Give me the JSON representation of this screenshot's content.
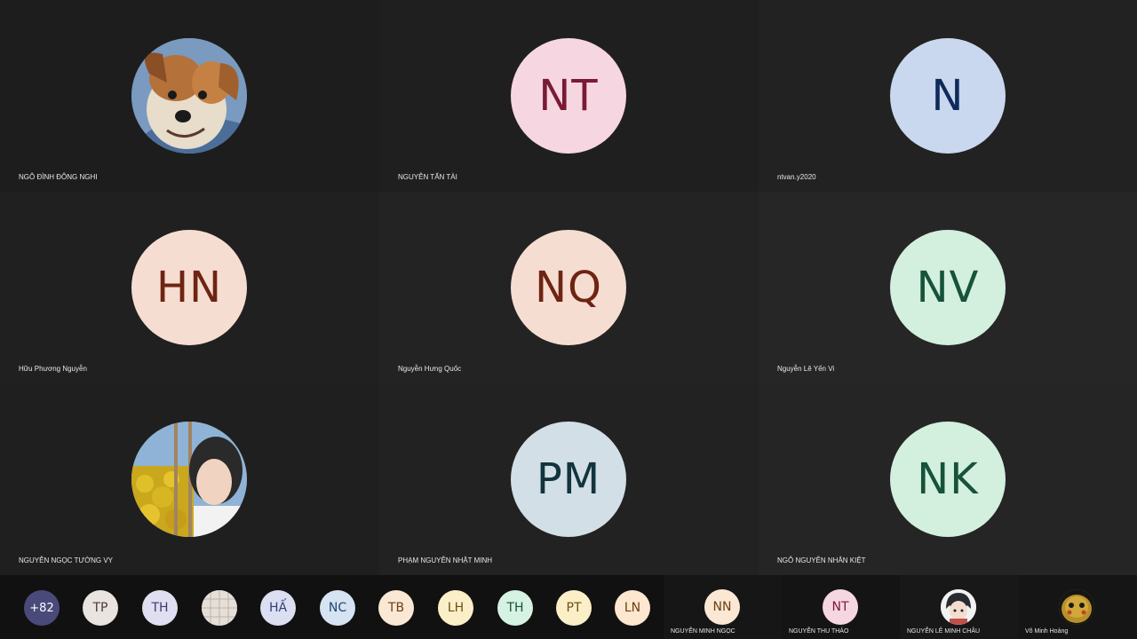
{
  "tiles": [
    {
      "name": "NGÔ ĐÌNH ĐÔNG NGHI",
      "initials": "",
      "photo": "dog",
      "bg": "#9a7a5a",
      "fg": "#000"
    },
    {
      "name": "NGUYỄN TẤN TÀI",
      "initials": "NT",
      "bg": "#f6d7e1",
      "fg": "#7a1a36"
    },
    {
      "name": "ntvan.y2020",
      "initials": "N",
      "bg": "#c9d8ee",
      "fg": "#102a5c"
    },
    {
      "name": "Hữu Phương Nguyễn",
      "initials": "HN",
      "bg": "#f6ddd2",
      "fg": "#6e2412"
    },
    {
      "name": "Nguyễn Hưng Quốc",
      "initials": "NQ",
      "bg": "#f6ddd2",
      "fg": "#6e2412"
    },
    {
      "name": "Nguyễn Lê Yến Vi",
      "initials": "NV",
      "bg": "#d3efdd",
      "fg": "#17523a"
    },
    {
      "name": "NGUYỄN NGỌC TƯỜNG VY",
      "initials": "",
      "photo": "girl",
      "bg": "#6f8a5a",
      "fg": "#000"
    },
    {
      "name": "PHẠM NGUYỄN NHẬT MINH",
      "initials": "PM",
      "bg": "#d3dfe6",
      "fg": "#12343d"
    },
    {
      "name": "NGÔ NGUYỄN NHÂN KIỆT",
      "initials": "NK",
      "bg": "#d3efdd",
      "fg": "#17523a"
    }
  ],
  "strip": {
    "overflow_count": "+82",
    "chips": [
      {
        "initials": "TP",
        "bg": "#eae4e0",
        "fg": "#4a3a33"
      },
      {
        "initials": "TH",
        "bg": "#e0dff1",
        "fg": "#3c3a6e"
      },
      {
        "initials": "",
        "photo": "pattern",
        "bg": "#d9d2cc",
        "fg": "#000"
      },
      {
        "initials": "HẤ",
        "bg": "#dcdff2",
        "fg": "#30407a"
      },
      {
        "initials": "NC",
        "bg": "#d5e3f2",
        "fg": "#23466e"
      },
      {
        "initials": "TB",
        "bg": "#fae8d4",
        "fg": "#6e3e12"
      },
      {
        "initials": "LH",
        "bg": "#fbefc8",
        "fg": "#6e5012"
      },
      {
        "initials": "TH",
        "bg": "#d6f2e2",
        "fg": "#17523a"
      },
      {
        "initials": "PT",
        "bg": "#fbefc8",
        "fg": "#6e5012"
      },
      {
        "initials": "LN",
        "bg": "#fde8cf",
        "fg": "#6e3e12"
      }
    ],
    "small_tiles": [
      {
        "name": "NGUYỄN MINH NGỌC",
        "initials": "NN",
        "bg": "#fae8d4",
        "fg": "#6e3e12"
      },
      {
        "name": "NGUYỄN THU THẢO",
        "initials": "NT",
        "bg": "#f6d7e1",
        "fg": "#7a1a36"
      },
      {
        "name": "NGUYỄN LÊ MINH CHÂU",
        "initials": "",
        "photo": "anime",
        "bg": "#e8e8e8",
        "fg": "#000"
      },
      {
        "name": "Võ Minh Hoàng",
        "initials": "",
        "photo": "pikachu",
        "bg": "#b08a2e",
        "fg": "#000"
      }
    ]
  },
  "colors": {
    "tile_dark": "#1d1d1d",
    "tile_mid": "#232323",
    "overflow_bg": "#4a4a7a"
  }
}
